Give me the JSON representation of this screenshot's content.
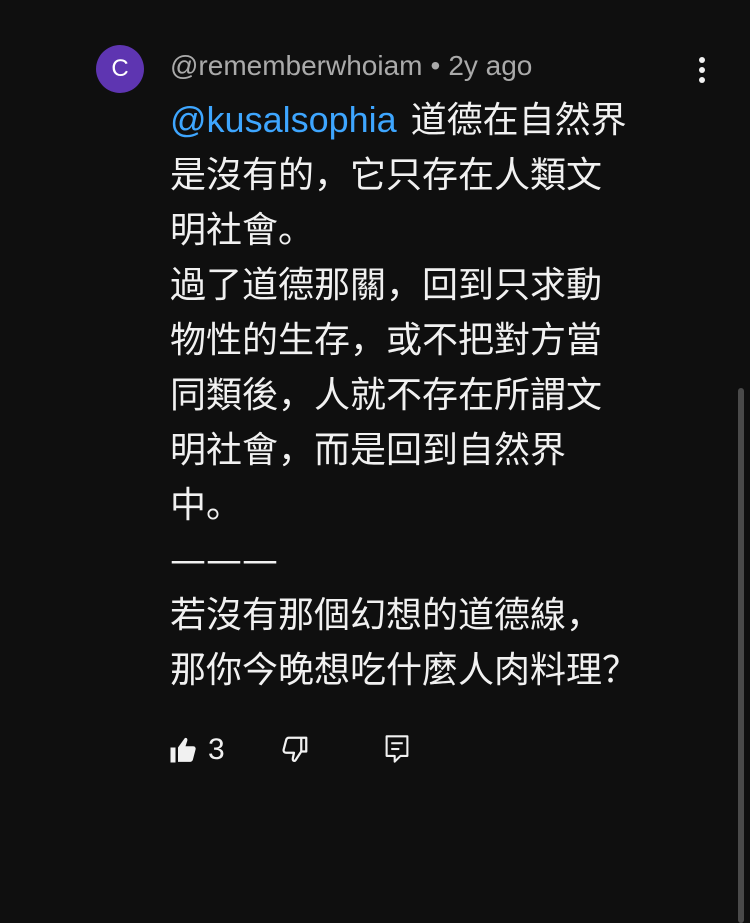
{
  "comment": {
    "avatar_letter": "C",
    "avatar_color": "#5e35b1",
    "author": "@rememberwhoiam",
    "separator": "•",
    "time_ago": "2y ago",
    "mention": "@kusalsophia",
    "lines": [
      "道德在自然界",
      "是沒有的，它只存在人類文",
      "明社會。",
      "過了道德那關，回到只求動",
      "物性的生存，或不把對方當",
      "同類後，人就不存在所謂文",
      "明社會，而是回到自然界",
      "中。",
      "———",
      "若沒有那個幻想的道德線，",
      "那你今晚想吃什麼人肉料理？"
    ],
    "like_count": "3"
  },
  "icons": {
    "more": "more-vert-icon",
    "like": "thumb-up-icon",
    "dislike": "thumb-down-icon",
    "reply": "reply-comment-icon"
  },
  "colors": {
    "background": "#0f0f0f",
    "text": "#f1f1f1",
    "secondary_text": "#aaaaaa",
    "mention": "#3ea6ff"
  }
}
